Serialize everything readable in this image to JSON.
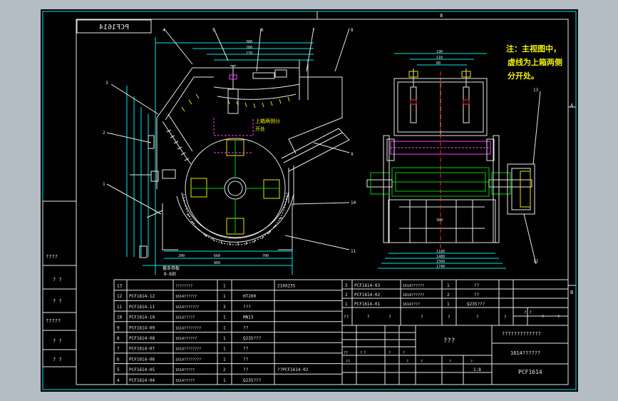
{
  "drawing": {
    "code_box": "PCF1614",
    "border_top_mark": "8",
    "border_letters": [
      "A",
      "B"
    ],
    "note": [
      "注：主视图中，",
      "虚线为上箱两侧",
      "分开处。"
    ],
    "label_upper_split": [
      "上箱两侧分",
      "开处"
    ],
    "label_bottom_view": "B-B剖",
    "label_bottom_grid": "篦条筛板",
    "side_labels": [
      "????",
      "? ?",
      "? ?",
      "?????",
      "? ?",
      "? ?"
    ],
    "callouts": [
      "1",
      "2",
      "3",
      "4",
      "5",
      "6",
      "7",
      "8",
      "9",
      "10",
      "11",
      "12",
      "13"
    ],
    "dims_top": [
      "380",
      "280",
      "270",
      "660",
      "860",
      "200",
      "700"
    ],
    "dims_right": [
      "190",
      "110",
      "80",
      "300",
      "1180",
      "1480",
      "1560",
      "1740"
    ]
  },
  "bom_left": {
    "rows": [
      {
        "no": "13",
        "code": "",
        "name": "????????",
        "qty": "1",
        "mat": "",
        "note": "210X235"
      },
      {
        "no": "12",
        "code": "PCF1614-12",
        "name": "1614??????",
        "qty": "1",
        "mat": "HT200",
        "note": ""
      },
      {
        "no": "11",
        "code": "PCF1614-11",
        "name": "1614???????",
        "qty": "3",
        "mat": "???",
        "note": ""
      },
      {
        "no": "10",
        "code": "PCF1614-10",
        "name": "1614?????",
        "qty": "1",
        "mat": "MN13",
        "note": ""
      },
      {
        "no": "9",
        "code": "PCF1614-09",
        "name": "1614????????",
        "qty": "1",
        "mat": "??",
        "note": ""
      },
      {
        "no": "8",
        "code": "PCF1614-08",
        "name": "1614??????",
        "qty": "1",
        "mat": "Q235???",
        "note": ""
      },
      {
        "no": "7",
        "code": "PCF1614-07",
        "name": "1614????????",
        "qty": "1",
        "mat": "??",
        "note": ""
      },
      {
        "no": "6",
        "code": "PCF1614-06",
        "name": "1614????????",
        "qty": "1",
        "mat": "??",
        "note": ""
      },
      {
        "no": "5",
        "code": "PCF1614-05",
        "name": "1614?????",
        "qty": "2",
        "mat": "??",
        "note": "??PCF1614-02"
      },
      {
        "no": "4",
        "code": "PCF1614-04",
        "name": "1614?????",
        "qty": "1",
        "mat": "Q235???",
        "note": ""
      }
    ]
  },
  "bom_right": {
    "rows": [
      {
        "no": "3",
        "code": "PCF1614-03",
        "name": "1614??????",
        "qty": "1",
        "mat": "??"
      },
      {
        "no": "2",
        "code": "PCF1614-02",
        "name": "1614??????",
        "qty": "2",
        "mat": "??"
      },
      {
        "no": "1",
        "code": "PCF1614-01",
        "name": "1614????",
        "qty": "1",
        "mat": "Q235???"
      }
    ],
    "header": [
      "??",
      "?",
      "?",
      "?",
      "?",
      "?",
      "?",
      "?",
      "? ?",
      "?",
      "?"
    ]
  },
  "title_block": {
    "company": "?????????????",
    "center": "???",
    "drawing_name": "1614??????",
    "drawing_no": "PCF1614",
    "scale": "1:8",
    "small": [
      "??",
      "?",
      "??",
      "?",
      "?",
      "?",
      "?",
      "?",
      "?",
      "?"
    ]
  }
}
